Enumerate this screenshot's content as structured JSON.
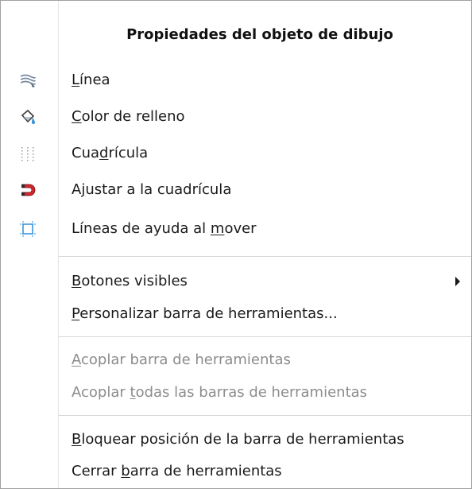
{
  "menu": {
    "title": "Propiedades del objeto de dibujo",
    "items": [
      {
        "pre": "",
        "acc": "L",
        "post": "ínea",
        "icon": "line-icon",
        "disabled": false
      },
      {
        "pre": "",
        "acc": "C",
        "post": "olor de relleno",
        "icon": "fill-color-icon",
        "disabled": false
      },
      {
        "pre": "Cua",
        "acc": "d",
        "post": "rícula",
        "icon": "grid-icon",
        "disabled": false
      },
      {
        "pre": "A",
        "acc": "j",
        "post": "ustar a la cuadrícula",
        "icon": "snap-magnet-icon",
        "disabled": false
      },
      {
        "pre": "Líneas de ayuda al ",
        "acc": "m",
        "post": "over",
        "icon": "helplines-icon",
        "disabled": false
      },
      {
        "pre": "",
        "acc": "B",
        "post": "otones visibles",
        "icon": "",
        "disabled": false,
        "submenu": true
      },
      {
        "pre": "",
        "acc": "P",
        "post": "ersonalizar barra de herramientas...",
        "icon": "",
        "disabled": false
      },
      {
        "pre": "",
        "acc": "A",
        "post": "coplar barra de herramientas",
        "icon": "",
        "disabled": true
      },
      {
        "pre": "Acoplar ",
        "acc": "t",
        "post": "odas las barras de herramientas",
        "icon": "",
        "disabled": true
      },
      {
        "pre": "",
        "acc": "B",
        "post": "loquear posición de la barra de herramientas",
        "icon": "",
        "disabled": false
      },
      {
        "pre": "Cerrar ",
        "acc": "b",
        "post": "arra de herramientas",
        "icon": "",
        "disabled": false
      }
    ]
  },
  "colors": {
    "text": "#1a1a1a",
    "disabled_text": "#8c8c8c",
    "separator": "#d7d7d7",
    "icon_blue": "#2f8fd8",
    "icon_red": "#d5262e"
  }
}
